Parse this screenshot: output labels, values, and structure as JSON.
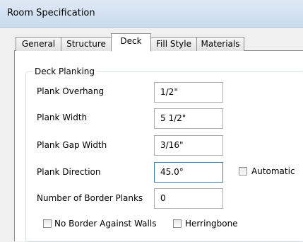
{
  "window": {
    "title": "Room Specification"
  },
  "tabs": [
    {
      "label": "General",
      "active": false
    },
    {
      "label": "Structure",
      "active": false
    },
    {
      "label": "Deck",
      "active": true
    },
    {
      "label": "Fill Style",
      "active": false
    },
    {
      "label": "Materials",
      "active": false
    }
  ],
  "group": {
    "title": "Deck Planking"
  },
  "fields": {
    "plank_overhang": {
      "label": "Plank Overhang",
      "value": "1/2\""
    },
    "plank_width": {
      "label": "Plank Width",
      "value": "5 1/2\""
    },
    "plank_gap_width": {
      "label": "Plank Gap Width",
      "value": "3/16\""
    },
    "plank_direction": {
      "label": "Plank Direction",
      "value": "45.0°"
    },
    "border_planks": {
      "label": "Number of Border Planks",
      "value": "0"
    }
  },
  "checkboxes": {
    "automatic": {
      "label": "Automatic",
      "checked": false
    },
    "no_border_against_walls": {
      "label": "No Border Against Walls",
      "checked": false
    },
    "herringbone": {
      "label": "Herringbone",
      "checked": false
    }
  }
}
